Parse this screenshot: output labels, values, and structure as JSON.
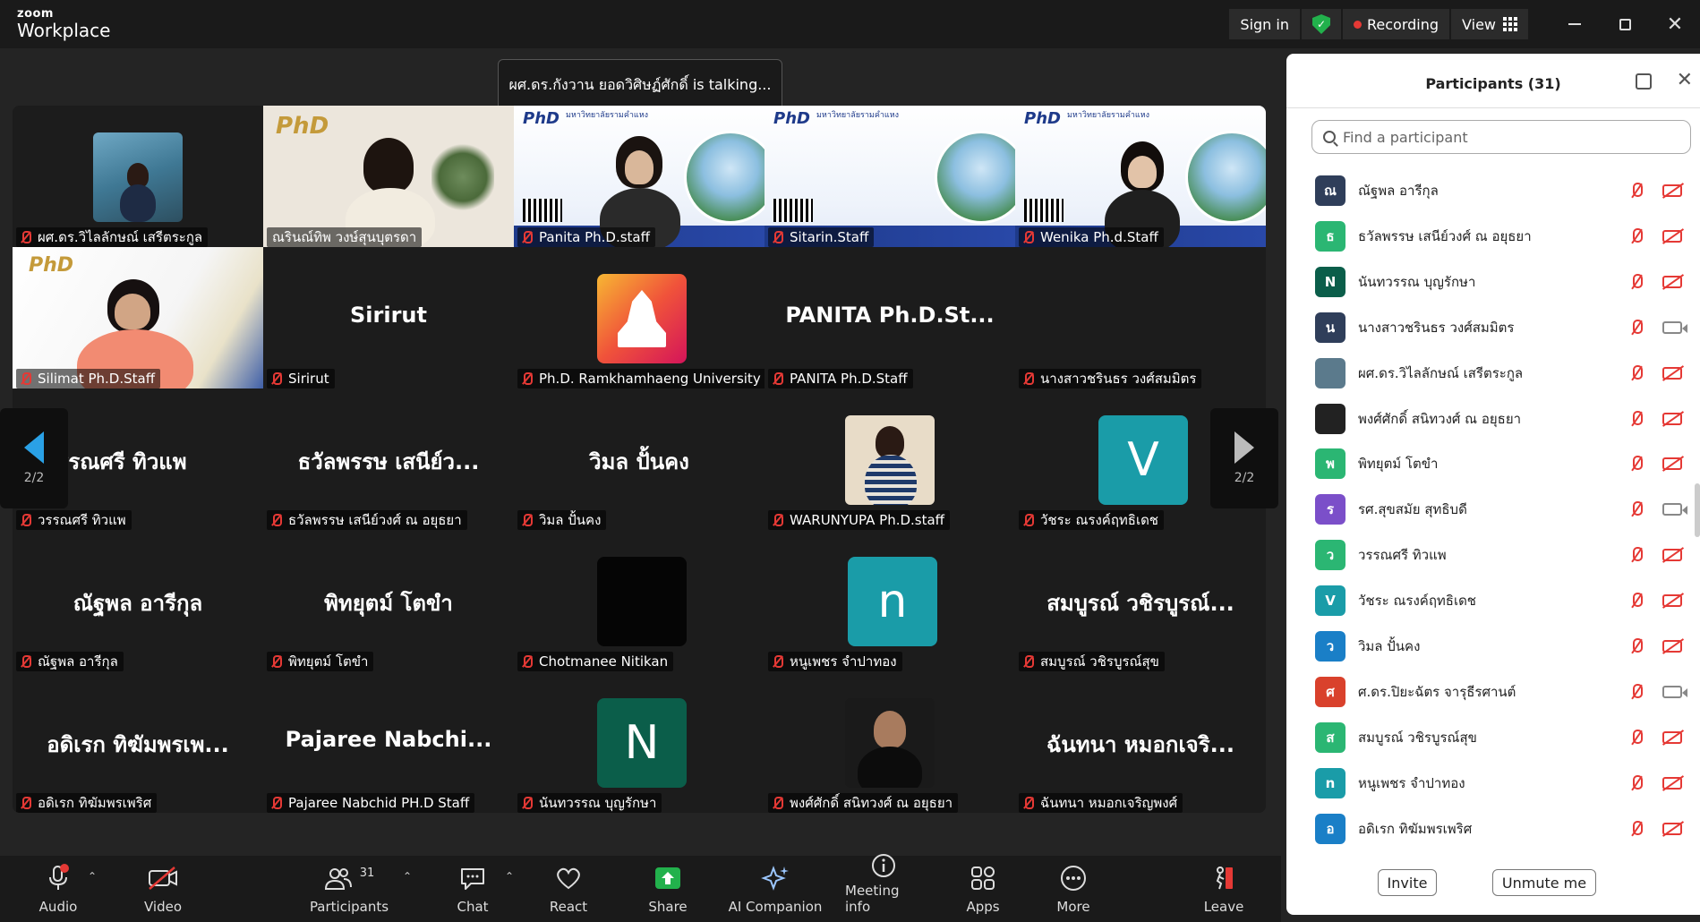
{
  "brand": {
    "line1": "zoom",
    "line2": "Workplace"
  },
  "topbar": {
    "sign_in": "Sign in",
    "recording": "Recording",
    "view": "View"
  },
  "talking": "ผศ.ดร.กังวาน  ยอดวิศิษฏ์ศักดิ์ is talking...",
  "pager": {
    "left": "2/2",
    "right": "2/2"
  },
  "tiles": [
    {
      "label": "ผศ.ดร.วิไลลักษณ์  เสรีตระกูล"
    },
    {
      "label": "ณรินณ์ทิพ วงษ์สุนบุตรดา"
    },
    {
      "label": "Panita Ph.D.staff"
    },
    {
      "label": "Sitarin.Staff"
    },
    {
      "label": "Wenika Ph.d.Staff"
    },
    {
      "label": "Silimat Ph.D.Staff"
    },
    {
      "big": "Sirirut",
      "label": "Sirirut"
    },
    {
      "label": "Ph.D. Ramkhamhaeng University"
    },
    {
      "big": "PANITA  Ph.D.St...",
      "label": "PANITA Ph.D.Staff"
    },
    {
      "label": "นางสาวชรินธร วงศ์สมมิตร"
    },
    {
      "big": "วรรณศรี  ทิวแพ",
      "label": "วรรณศรี  ทิวแพ"
    },
    {
      "big": "ธวัลพรรษ เสนีย์ว...",
      "label": "ธวัลพรรษ เสนีย์วงศ์ ณ อยุธยา"
    },
    {
      "big": "วิมล ปั้นคง",
      "label": "วิมล ปั้นคง"
    },
    {
      "label": "WARUNYUPA Ph.D.staff"
    },
    {
      "avatar": "V",
      "label": "วัชระ ณรงค์ฤทธิเดช"
    },
    {
      "big": "ณัฐพล อารีกุล",
      "label": "ณัฐพล อารีกุล"
    },
    {
      "big": "พิทยุตม์ โตขำ",
      "label": "พิทยุตม์ โตขำ"
    },
    {
      "label": "Chotmanee Nitikan"
    },
    {
      "avatar": "n",
      "label": "หนูเพชร จำปาทอง"
    },
    {
      "big": "สมบูรณ์ วชิรบูรณ์...",
      "label": "สมบูรณ์ วชิรบูรณ์สุข"
    },
    {
      "big": "อดิเรก ทิฆัมพรเพ...",
      "label": "อดิเรก ทิฆัมพรเพริศ"
    },
    {
      "big": "Pajaree  Nabchi...",
      "label": "Pajaree Nabchid PH.D Staff"
    },
    {
      "avatar": "N",
      "label": "นันทวรรณ บุญรักษา"
    },
    {
      "label": "พงศ์ศักดิ์ สนิทวงศ์ ณ อยุธยา"
    },
    {
      "big": "ฉันทนา หมอกเจริ...",
      "label": "ฉันทนา หมอกเจริญพงศ์"
    }
  ],
  "toolbar": {
    "audio": "Audio",
    "video": "Video",
    "participants": "Participants",
    "participants_count": "31",
    "chat": "Chat",
    "react": "React",
    "share": "Share",
    "ai": "AI Companion",
    "meeting_info": "Meeting info",
    "apps": "Apps",
    "more": "More",
    "leave": "Leave"
  },
  "panel": {
    "title": "Participants (31)",
    "search_placeholder": "Find a participant",
    "invite": "Invite",
    "unmute": "Unmute me",
    "participants": [
      {
        "initial": "ณ",
        "color": "#2f3e5a",
        "name": "ณัฐพล อารีกุล",
        "cam": "off"
      },
      {
        "initial": "ธ",
        "color": "#2bb673",
        "name": "ธวัลพรรษ เสนีย์วงศ์ ณ อยุธยา",
        "cam": "off"
      },
      {
        "initial": "N",
        "color": "#0b5e4a",
        "name": "นันทวรรณ บุญรักษา",
        "cam": "off"
      },
      {
        "initial": "น",
        "color": "#2f3e5a",
        "name": "นางสาวชรินธร วงศ์สมมิตร",
        "cam": "on"
      },
      {
        "initial": "",
        "color": "#5b7a8c",
        "name": "ผศ.ดร.วิไลลักษณ์  เสรีตระกูล",
        "cam": "off"
      },
      {
        "initial": "",
        "color": "#222222",
        "name": "พงศ์ศักดิ์ สนิทวงศ์ ณ อยุธยา",
        "cam": "off"
      },
      {
        "initial": "พ",
        "color": "#2bb673",
        "name": "พิทยุตม์ โตขำ",
        "cam": "off"
      },
      {
        "initial": "ร",
        "color": "#7b4fc9",
        "name": "รศ.สุขสมัย สุทธิบดี",
        "cam": "on"
      },
      {
        "initial": "ว",
        "color": "#2bb673",
        "name": "วรรณศรี  ทิวแพ",
        "cam": "off"
      },
      {
        "initial": "V",
        "color": "#1a9ca8",
        "name": "วัชระ ณรงค์ฤทธิเดช",
        "cam": "off"
      },
      {
        "initial": "ว",
        "color": "#1a7fc7",
        "name": "วิมล ปั้นคง",
        "cam": "off"
      },
      {
        "initial": "ศ",
        "color": "#d9412c",
        "name": "ศ.ดร.ปิยะฉัตร  จารุธีรศานต์",
        "cam": "on"
      },
      {
        "initial": "ส",
        "color": "#2bb673",
        "name": "สมบูรณ์ วชิรบูรณ์สุข",
        "cam": "off"
      },
      {
        "initial": "n",
        "color": "#1a9ca8",
        "name": "หนูเพชร จำปาทอง",
        "cam": "off"
      },
      {
        "initial": "อ",
        "color": "#1a7fc7",
        "name": "อดิเรก ทิฆัมพรเพริศ",
        "cam": "off"
      }
    ]
  }
}
